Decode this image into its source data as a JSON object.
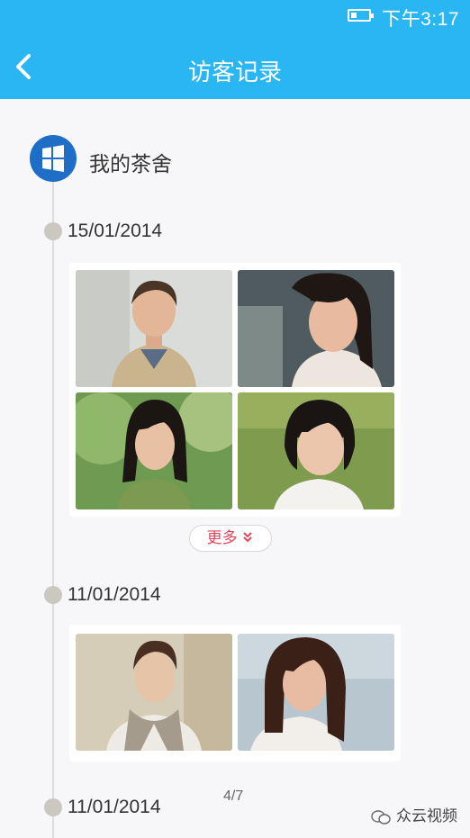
{
  "status_bar": {
    "time": "下午3:17",
    "battery_level": 0.25
  },
  "nav": {
    "title": "访客记录",
    "back_icon": "chevron-left-icon"
  },
  "shop": {
    "name": "我的茶舍",
    "icon": "windows-logo-icon"
  },
  "groups": [
    {
      "date": "15/01/2014",
      "photos": [
        {
          "description": "man in trench coat"
        },
        {
          "description": "woman in white blazer"
        },
        {
          "description": "woman in green dress"
        },
        {
          "description": "woman with bob haircut"
        }
      ],
      "more_label": "更多"
    },
    {
      "date": "11/01/2014",
      "photos": [
        {
          "description": "woman with scarf"
        },
        {
          "description": "woman with long hair"
        }
      ]
    },
    {
      "date": "11/01/2014"
    }
  ],
  "page_indicator": "4/7",
  "watermark": "众云视频",
  "colors": {
    "header": "#2ab6f2",
    "accent": "#e0455a",
    "shop_icon": "#1e6ec8"
  }
}
